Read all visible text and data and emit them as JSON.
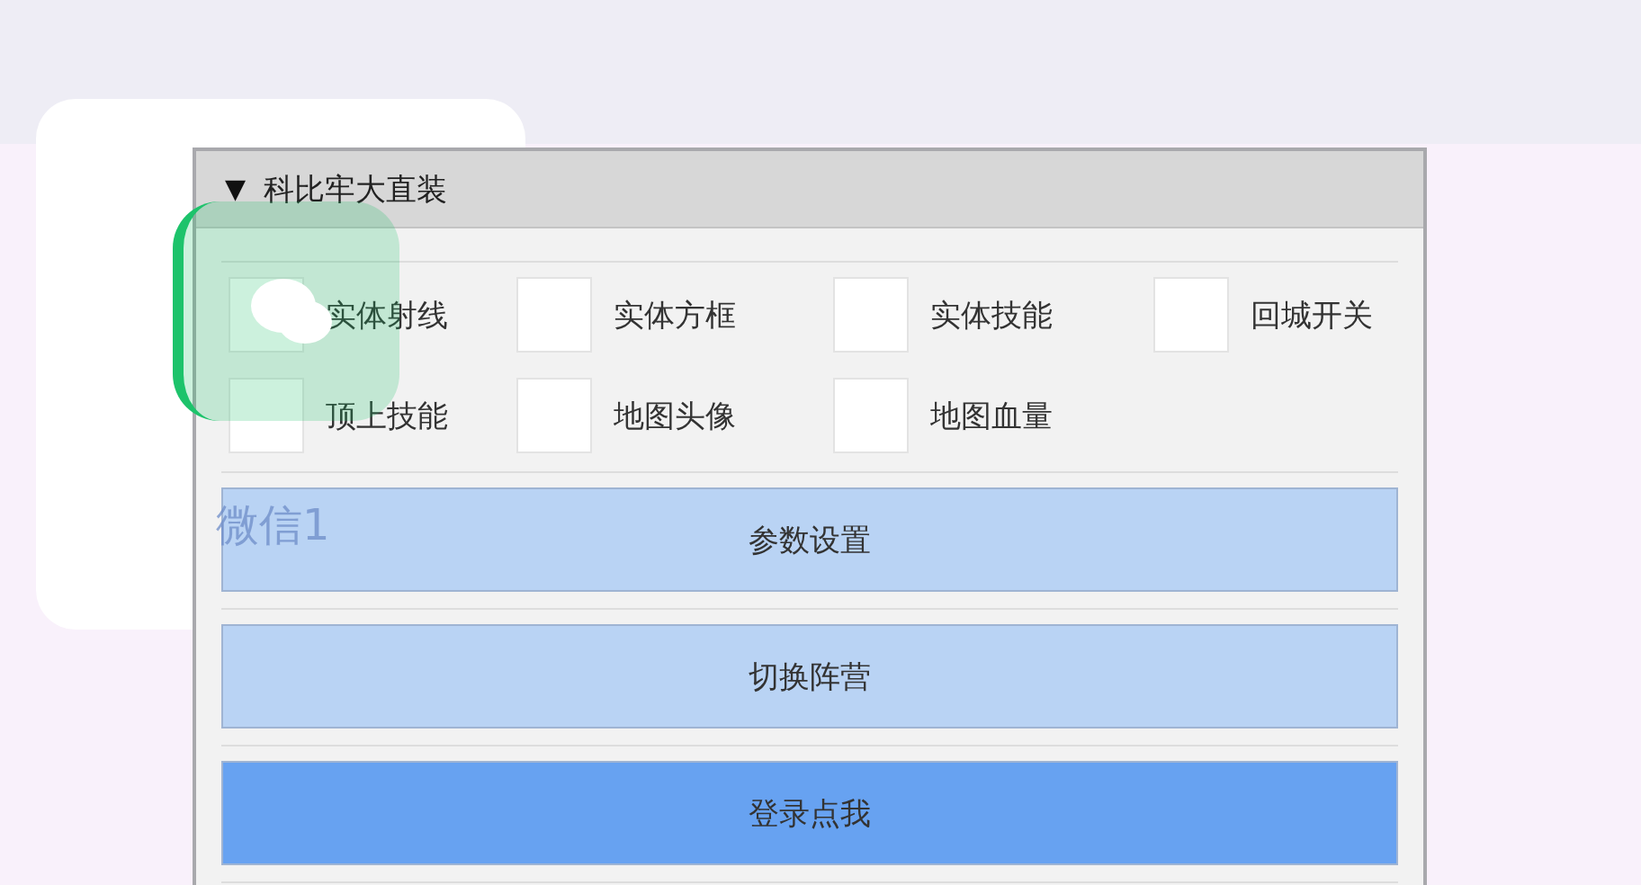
{
  "home_screen": {
    "app_icon": {
      "label": "微信1"
    }
  },
  "menu": {
    "toggle": "▼",
    "title": "科比牢大直装",
    "options": [
      {
        "label": "实体射线",
        "checked": false
      },
      {
        "label": "实体方框",
        "checked": false
      },
      {
        "label": "实体技能",
        "checked": false
      },
      {
        "label": "回城开关",
        "checked": false
      },
      {
        "label": "顶上技能",
        "checked": false
      },
      {
        "label": "地图头像",
        "checked": false
      },
      {
        "label": "地图血量",
        "checked": false
      }
    ],
    "buttons": [
      {
        "label": "参数设置",
        "kind": "normal"
      },
      {
        "label": "切换阵营",
        "kind": "normal"
      },
      {
        "label": "登录点我",
        "kind": "primary"
      }
    ]
  }
}
